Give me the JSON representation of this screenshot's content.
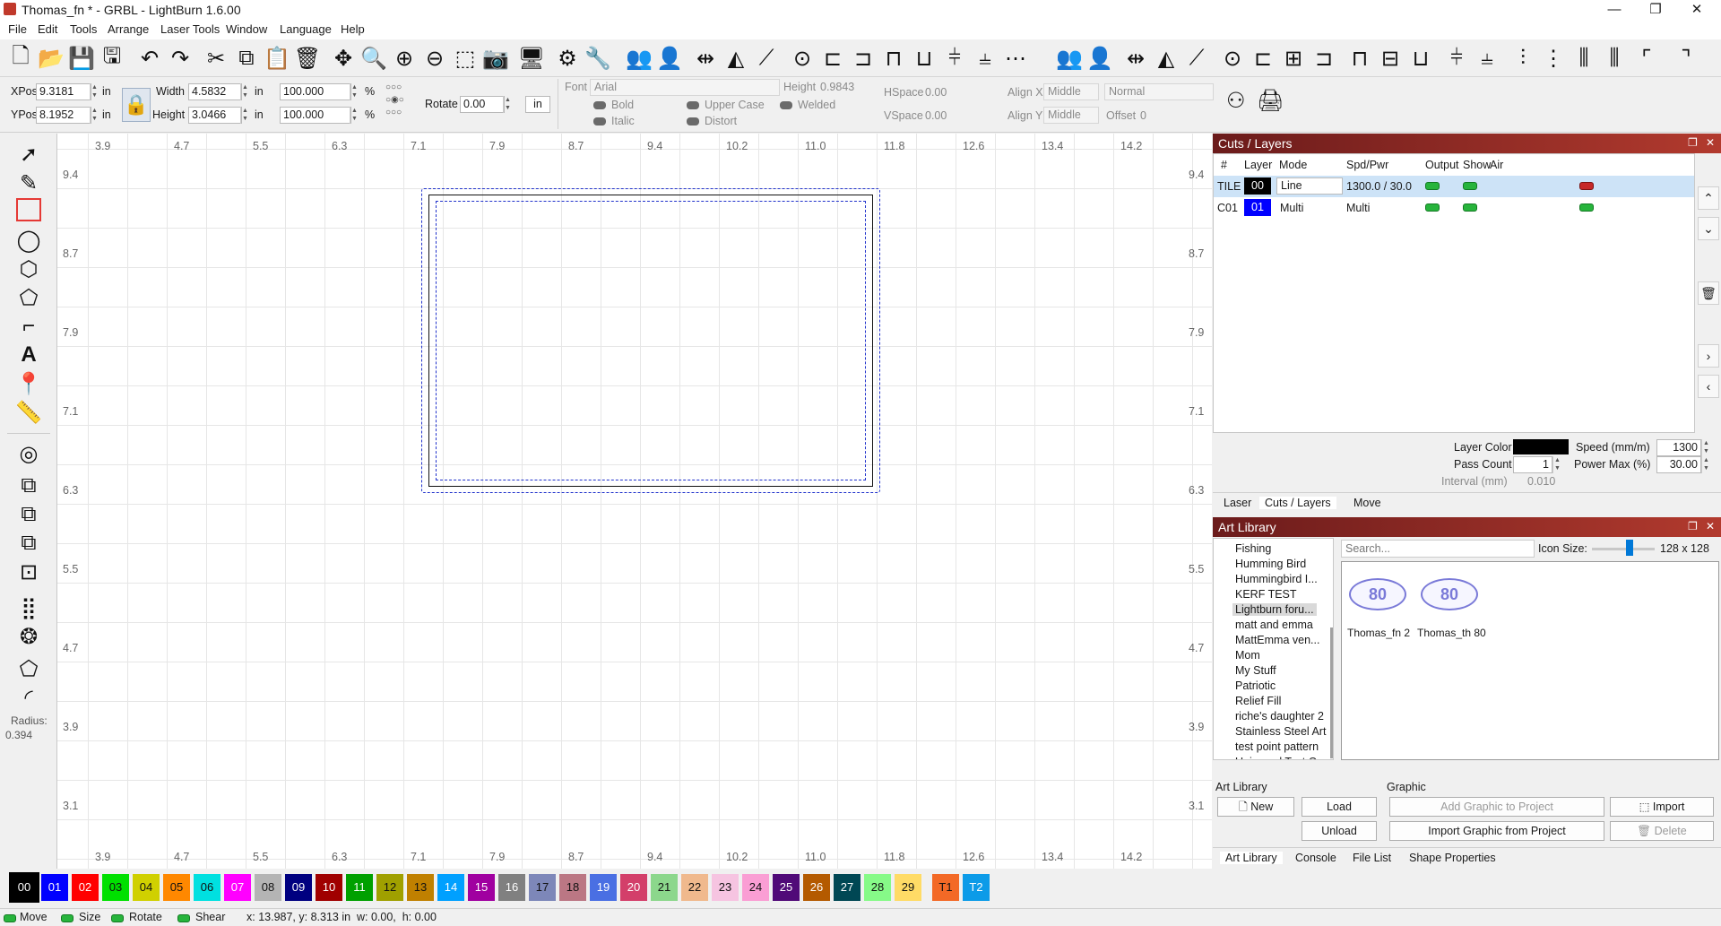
{
  "window": {
    "title": "Thomas_fn * - GRBL - LightBurn 1.6.00",
    "minimize": "—",
    "maximize": "❐",
    "close": "✕"
  },
  "menu": [
    "File",
    "Edit",
    "Tools",
    "Arrange",
    "Laser Tools",
    "Window",
    "Language",
    "Help"
  ],
  "props": {
    "xpos_label": "XPos",
    "xpos_value": "9.3181",
    "ypos_label": "YPos",
    "ypos_value": "8.1952",
    "unit": "in",
    "width_label": "Width",
    "width_value": "4.5832",
    "height_label": "Height",
    "height_value": "3.0466",
    "width_pct": "100.000",
    "height_pct": "100.000",
    "pct": "%",
    "rotate_label": "Rotate",
    "rotate_value": "0.00",
    "unit_button": "in",
    "font_label": "Font",
    "font_value": "Arial",
    "font_height_label": "Height",
    "font_height_value": "0.9843",
    "hspace_label": "HSpace",
    "hspace_value": "0.00",
    "vspace_label": "VSpace",
    "vspace_value": "0.00",
    "alignx_label": "Align X",
    "alignx_value": "Middle",
    "aligny_label": "Align Y",
    "aligny_value": "Middle",
    "mode_value": "Normal",
    "offset_label": "Offset",
    "offset_value": "0",
    "bold": "Bold",
    "italic": "Italic",
    "upper_case": "Upper Case",
    "distort": "Distort",
    "welded": "Welded"
  },
  "ruler": {
    "x_ticks": [
      "3.9",
      "4.7",
      "5.5",
      "6.3",
      "7.1",
      "7.9",
      "8.7",
      "9.4",
      "10.2",
      "11.0",
      "11.8",
      "12.6",
      "13.4",
      "14.2"
    ],
    "y_ticks": [
      "9.4",
      "8.7",
      "7.9",
      "7.1",
      "6.3",
      "5.5",
      "4.7",
      "3.9",
      "3.1"
    ]
  },
  "left_tools": {
    "radius_label": "Radius:",
    "radius_value": "0.394"
  },
  "cuts": {
    "title": "Cuts / Layers",
    "headers": [
      "#",
      "Layer",
      "Mode",
      "Spd/Pwr",
      "Output",
      "Show",
      "Air"
    ],
    "rows": [
      {
        "num": "TILE",
        "layer": "00",
        "mode": "Line",
        "spdpwr": "1300.0 / 30.0",
        "color": "#000000"
      },
      {
        "num": "C01",
        "layer": "01",
        "mode": "Multi",
        "spdpwr": "Multi",
        "color": "#0000ff"
      }
    ],
    "layer_color_label": "Layer Color",
    "speed_label": "Speed (mm/m)",
    "speed_value": "1300",
    "pass_label": "Pass Count",
    "pass_value": "1",
    "power_label": "Power Max (%)",
    "power_value": "30.00",
    "interval_label": "Interval (mm)",
    "interval_value": "0.010",
    "tabs": [
      "Laser",
      "Cuts / Layers",
      "Move"
    ]
  },
  "art": {
    "title": "Art Library",
    "items": [
      "Fishing",
      "Humming Bird",
      "Hummingbird I...",
      "KERF TEST",
      "Lightburn foru...",
      "matt and emma",
      "MattEmma ven...",
      "Mom",
      "My Stuff",
      "Patriotic",
      "Relief Fill",
      "riche's daughter 2",
      "Stainless Steel Art",
      "test point pattern",
      "Universal Test C..."
    ],
    "search_placeholder": "Search...",
    "icon_size_label": "Icon Size:",
    "icon_size_value": "128 x 128",
    "thumbs": [
      "Thomas_fn 2",
      "Thomas_th 80"
    ],
    "group_library": "Art Library",
    "group_graphic": "Graphic",
    "btn_new": "New",
    "btn_load": "Load",
    "btn_unload": "Unload",
    "btn_add": "Add Graphic to Project",
    "btn_import": "Import",
    "btn_import_from": "Import Graphic from Project",
    "btn_delete": "Delete",
    "tabs": [
      "Art Library",
      "Console",
      "File List",
      "Shape Properties"
    ]
  },
  "palette": [
    {
      "label": "00",
      "color": "#000000",
      "text": "#ffffff"
    },
    {
      "label": "01",
      "color": "#0000ff",
      "text": "#ffffff"
    },
    {
      "label": "02",
      "color": "#ff0000",
      "text": "#ffffff"
    },
    {
      "label": "03",
      "color": "#00e000",
      "text": "#111111"
    },
    {
      "label": "04",
      "color": "#d0d000",
      "text": "#111111"
    },
    {
      "label": "05",
      "color": "#ff8800",
      "text": "#111111"
    },
    {
      "label": "06",
      "color": "#00e0e0",
      "text": "#111111"
    },
    {
      "label": "07",
      "color": "#ff00ff",
      "text": "#ffffff"
    },
    {
      "label": "08",
      "color": "#b4b4b4",
      "text": "#111111"
    },
    {
      "label": "09",
      "color": "#000080",
      "text": "#ffffff"
    },
    {
      "label": "10",
      "color": "#a00000",
      "text": "#ffffff"
    },
    {
      "label": "11",
      "color": "#00a000",
      "text": "#ffffff"
    },
    {
      "label": "12",
      "color": "#a0a000",
      "text": "#111111"
    },
    {
      "label": "13",
      "color": "#c08000",
      "text": "#111111"
    },
    {
      "label": "14",
      "color": "#00a0ff",
      "text": "#ffffff"
    },
    {
      "label": "15",
      "color": "#a000a0",
      "text": "#ffffff"
    },
    {
      "label": "16",
      "color": "#808080",
      "text": "#ffffff"
    },
    {
      "label": "17",
      "color": "#7d87b9",
      "text": "#111111"
    },
    {
      "label": "18",
      "color": "#bb7784",
      "text": "#111111"
    },
    {
      "label": "19",
      "color": "#4a6fe3",
      "text": "#ffffff"
    },
    {
      "label": "20",
      "color": "#d33f6a",
      "text": "#ffffff"
    },
    {
      "label": "21",
      "color": "#8cd78c",
      "text": "#111111"
    },
    {
      "label": "22",
      "color": "#f0b98d",
      "text": "#111111"
    },
    {
      "label": "23",
      "color": "#f6c4e1",
      "text": "#111111"
    },
    {
      "label": "24",
      "color": "#fa9ed4",
      "text": "#111111"
    },
    {
      "label": "25",
      "color": "#500a78",
      "text": "#ffffff"
    },
    {
      "label": "26",
      "color": "#b45a00",
      "text": "#ffffff"
    },
    {
      "label": "27",
      "color": "#004754",
      "text": "#ffffff"
    },
    {
      "label": "28",
      "color": "#86fa88",
      "text": "#111111"
    },
    {
      "label": "29",
      "color": "#ffdb66",
      "text": "#111111"
    },
    {
      "label": "T1",
      "color": "#f36926",
      "text": "#111111"
    },
    {
      "label": "T2",
      "color": "#0c9be8",
      "text": "#ffffff"
    }
  ],
  "status": {
    "move": "Move",
    "size": "Size",
    "rotate": "Rotate",
    "shear": "Shear",
    "coords": "x: 13.987, y: 8.313 in  w: 0.00,  h: 0.00"
  }
}
